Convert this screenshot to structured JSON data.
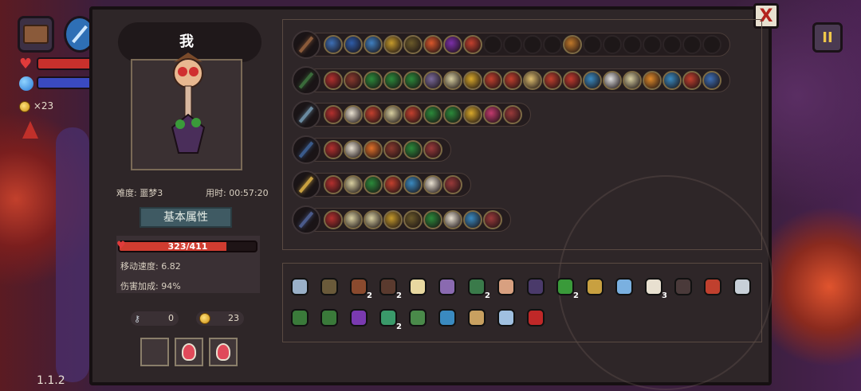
{
  "hud": {
    "coin_count": "×23",
    "version": "1.1.2",
    "pause_label": "II"
  },
  "panel": {
    "close_label": "X"
  },
  "character": {
    "name": "我",
    "difficulty": "难度: 噩梦3",
    "time": "用时: 00:57:20",
    "attributes_title": "基本属性",
    "hp_text": "323/411",
    "hp_fraction": 0.786,
    "move_speed": "移动速度: 6.82",
    "damage_bonus": "伤害加成: 94%",
    "keys": "0",
    "coins": "23"
  },
  "weapon_rows": [
    {
      "spells": [
        "#3d6fb5",
        "#2e5ca8",
        "#3f7fc0",
        "#c59a2c",
        "#6b5a2a",
        "#d9572b",
        "#7b2fa8",
        "#c3402e",
        "",
        "",
        "",
        "",
        "#c0782a",
        "",
        "",
        "",
        "",
        "",
        "",
        ""
      ]
    },
    {
      "spells": [
        "#b3302e",
        "#8a3a2e",
        "#2b8a3a",
        "#2b8a3a",
        "#2b8a3a",
        "#7a6a9a",
        "#d8cfa0",
        "#d8a82b",
        "#c3402e",
        "#c3402e",
        "#e0c070",
        "#c3402e",
        "#c33a2e",
        "#3a8ac0",
        "#e0e0e0",
        "#d8cfa0",
        "#e08a2a",
        "#3a8ac0",
        "#c3402e",
        "#3d6fb5"
      ]
    },
    {
      "spells": [
        "#b3302e",
        "#e8e0d0",
        "#c3402e",
        "#d8cfa0",
        "#c3402e",
        "#2b8a3a",
        "#2b8a3a",
        "#d8a82b",
        "#c33a6e",
        "#9a3a3a"
      ]
    },
    {
      "spells": [
        "#b3302e",
        "#e8e0d0",
        "#e0702a",
        "#8a3a2e",
        "#2b8a3a",
        "#9a3a3a"
      ]
    },
    {
      "spells": [
        "#b3302e",
        "#d8cfa0",
        "#2b8a3a",
        "#c3402e",
        "#3a8ac0",
        "#e8e0d0",
        "#9a3a3a"
      ]
    },
    {
      "spells": [
        "#b3302e",
        "#d8cfa0",
        "#d8cfa0",
        "#c59a2c",
        "#6b5a2a",
        "#2b8a3a",
        "#e8e0d0",
        "#3a8ac0",
        "#9a3a3a"
      ]
    }
  ],
  "items_row1": [
    {
      "icon": "shield-icon",
      "color": "#9ab0c8",
      "count": ""
    },
    {
      "icon": "horn-icon",
      "color": "#6a5a3a",
      "count": ""
    },
    {
      "icon": "armor-icon",
      "color": "#8a4a2e",
      "count": "2"
    },
    {
      "icon": "cloak-icon",
      "color": "#5a3a2e",
      "count": "2"
    },
    {
      "icon": "tooth-icon",
      "color": "#e8d8a0",
      "count": ""
    },
    {
      "icon": "scroll-icon",
      "color": "#8a6ab0",
      "count": ""
    },
    {
      "icon": "whip-icon",
      "color": "#3a7a4a",
      "count": "2"
    },
    {
      "icon": "egg-icon",
      "color": "#d8a080",
      "count": ""
    },
    {
      "icon": "robe-icon",
      "color": "#4a3a6a",
      "count": ""
    },
    {
      "icon": "slime-icon",
      "color": "#3a9a3a",
      "count": "2"
    },
    {
      "icon": "lantern-icon",
      "color": "#c8a040",
      "count": ""
    },
    {
      "icon": "wings-icon",
      "color": "#7ab0e0",
      "count": ""
    },
    {
      "icon": "fangs-icon",
      "color": "#e8e0d0",
      "count": "3"
    },
    {
      "icon": "spider-icon",
      "color": "#4a3a3a",
      "count": ""
    },
    {
      "icon": "flame-icon",
      "color": "#c0402e",
      "count": ""
    },
    {
      "icon": "watch-icon",
      "color": "#c8d0d8",
      "count": ""
    }
  ],
  "items_row2": [
    {
      "icon": "boot-icon",
      "color": "#3a7a3a",
      "count": ""
    },
    {
      "icon": "hat-icon",
      "color": "#3a7a3a",
      "count": ""
    },
    {
      "icon": "cape-icon",
      "color": "#7a3ab0",
      "count": ""
    },
    {
      "icon": "gloves-icon",
      "color": "#3a9a6a",
      "count": "2"
    },
    {
      "icon": "gear-icon",
      "color": "#4a8a4a",
      "count": ""
    },
    {
      "icon": "ring-icon",
      "color": "#3a8ac0",
      "count": ""
    },
    {
      "icon": "hourglass-icon",
      "color": "#c8a060",
      "count": ""
    },
    {
      "icon": "key-icon",
      "color": "#a0c0e0",
      "count": ""
    },
    {
      "icon": "orb-icon",
      "color": "#c02828",
      "count": ""
    }
  ]
}
